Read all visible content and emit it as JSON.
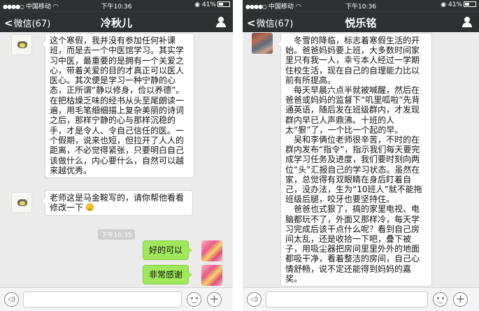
{
  "phone_left": {
    "status": {
      "carrier": "中国移动",
      "time": "下午10:36",
      "battery": "41%",
      "battery_level": 0.41
    },
    "nav": {
      "back_label": "微信(67)",
      "title": "冷秋儿"
    },
    "messages": [
      {
        "from": "teacher",
        "text": "这个寒假，我并没有参加任何补课班，而是去一个中医馆学习。其实学习中医，最重要的是拥有一个关爱之心，带着关爱的目的才真正可以医人医心。其次便是学习一种宁静的心态，正所谓“静以修身，俭以养德”。在把枯燥乏味的经书从头至尾朗读一遍，用毛笔细细描上复杂美丽的诗词之后，那样宁静的心与那样沉稳的手，才是令人、令自己信任的医。一个假期，说来也短，但拉开了人人的距离，不必觉得紧张，只要明白自己该做什么，内心要什么，自然可以越来越优秀。"
      },
      {
        "from": "teacher",
        "text": "老师这是马金鞍写的，请你帮他看看修改一下"
      },
      {
        "timestamp": "下午10:35"
      },
      {
        "from": "me",
        "text": "好的可以"
      },
      {
        "from": "me",
        "text": "非常感谢"
      }
    ]
  },
  "phone_right": {
    "status": {
      "carrier": "中国移动",
      "time": "下午10:36",
      "battery": "41%",
      "battery_level": 0.41
    },
    "nav": {
      "back_label": "微信(67)",
      "title": "悦乐铭"
    },
    "messages": [
      {
        "from": "parent",
        "text": "　冬雪的降临，标志着寒假生活的开始。爸爸妈妈要上班，大多数时间家里只有我一人，幸亏本人经过一学期住校生活，现在自己的自理能力比以前有所提高。\n　每天早晨六点半就被喊醒，然后在爸爸或妈妈的监督下“叽里呱啦”先背通英语，随后发在班级群内，才发现群内早已人声鼎沸。十班的人太“狠”了，一个比一个起的早。\n　吴和李俩位老师很辛苦，不时的在群内发布“指令”，指示我们每天要完成学习任务及进度，我们要时刻向两位“头”汇报自己的学习状态。虽然在家，总觉得有双眼睛在身后盯着自己，没办法，生为“10班人”就不能拖班级后腿，咬牙也要坚持住。\n　爸爸也式狠了，搞的家里电视、电脑都玩不了，外面又那样冷，每天学习完成后该干点什么呢？看到自己房间太乱，还是收拾一下吧，叠下被子，用吸尘器把房间里里外外的地面都吸干净，看着整洁的房间，自己心情舒畅，说不定还能得到妈妈的嘉奖。"
      }
    ]
  }
}
